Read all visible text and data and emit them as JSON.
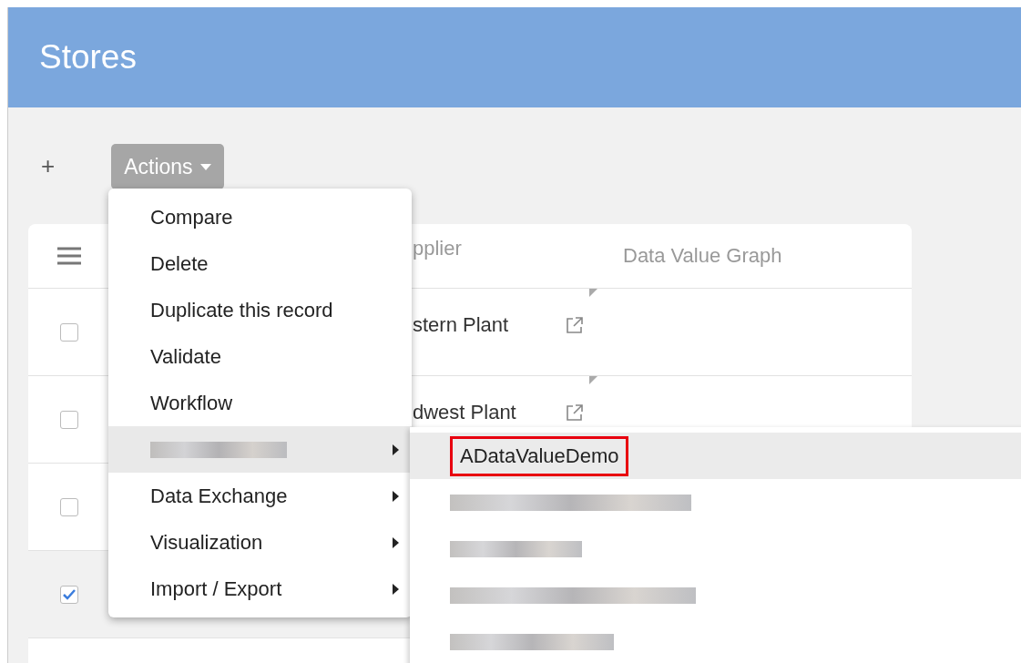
{
  "header": {
    "title": "Stores"
  },
  "toolbar": {
    "add": "+",
    "actions": "Actions"
  },
  "table": {
    "columns": [
      "pplier",
      "Data Value Graph"
    ],
    "rows": [
      {
        "checked": false,
        "selected": false,
        "supplier": "stern Plant",
        "link": true,
        "flag": true
      },
      {
        "checked": false,
        "selected": false,
        "supplier": "dwest Plant",
        "link": true,
        "flag": true
      },
      {
        "checked": false,
        "selected": false,
        "link": false,
        "flag": false
      },
      {
        "checked": true,
        "selected": true,
        "link": false,
        "flag": false
      }
    ]
  },
  "menu": {
    "items": [
      {
        "kind": "text",
        "label": "Compare",
        "submenu": false,
        "selected": false
      },
      {
        "kind": "text",
        "label": "Delete",
        "submenu": false,
        "selected": false
      },
      {
        "kind": "text",
        "label": "Duplicate this record",
        "submenu": false,
        "selected": false
      },
      {
        "kind": "text",
        "label": "Validate",
        "submenu": false,
        "selected": false
      },
      {
        "kind": "text",
        "label": "Workflow",
        "submenu": false,
        "selected": false
      },
      {
        "kind": "redacted",
        "submenu": true,
        "selected": true
      },
      {
        "kind": "text",
        "label": "Data Exchange",
        "submenu": true,
        "selected": false
      },
      {
        "kind": "text",
        "label": "Visualization",
        "submenu": true,
        "selected": false
      },
      {
        "kind": "text",
        "label": "Import / Export",
        "submenu": true,
        "selected": false
      }
    ]
  },
  "submenu": {
    "items": [
      {
        "kind": "text",
        "label": "ADataValueDemo",
        "selected": true,
        "highlighted": true
      },
      {
        "kind": "redacted",
        "selected": false,
        "highlighted": false
      },
      {
        "kind": "redacted",
        "selected": false,
        "highlighted": false
      },
      {
        "kind": "redacted",
        "selected": false,
        "highlighted": false
      },
      {
        "kind": "redacted",
        "selected": false,
        "highlighted": false
      }
    ]
  }
}
